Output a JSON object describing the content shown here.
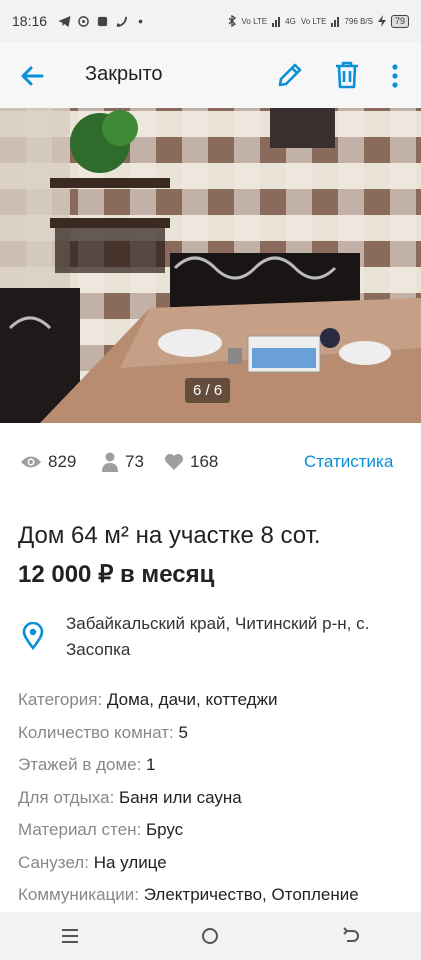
{
  "statusbar": {
    "time": "18:16",
    "net1": "Vo LTE",
    "net2": "4G",
    "net3": "Vo LTE",
    "speed": "796",
    "speed_unit": "B/S",
    "battery": "79"
  },
  "appbar": {
    "title": "Закрыто"
  },
  "photo": {
    "counter": "6 / 6"
  },
  "stats": {
    "views": "829",
    "contacts": "73",
    "favorites": "168",
    "statistics_link": "Статистика"
  },
  "listing": {
    "title": "Дом 64 м² на участке 8 сот.",
    "price": "12 000 ₽ в месяц",
    "address": "Забайкальский край, Читинский р-н, с. Засопка"
  },
  "params": [
    {
      "key": "Категория:",
      "value": "Дома, дачи, коттеджи"
    },
    {
      "key": "Количество комнат:",
      "value": "5"
    },
    {
      "key": "Этажей в доме:",
      "value": "1"
    },
    {
      "key": "Для отдыха:",
      "value": "Баня или сауна"
    },
    {
      "key": "Материал стен:",
      "value": "Брус"
    },
    {
      "key": "Санузел:",
      "value": "На улице"
    },
    {
      "key": "Коммуникации:",
      "value": "Электричество, Отопление"
    }
  ],
  "colors": {
    "accent": "#0a8fd8",
    "icon_gray": "#9e9e9e"
  }
}
